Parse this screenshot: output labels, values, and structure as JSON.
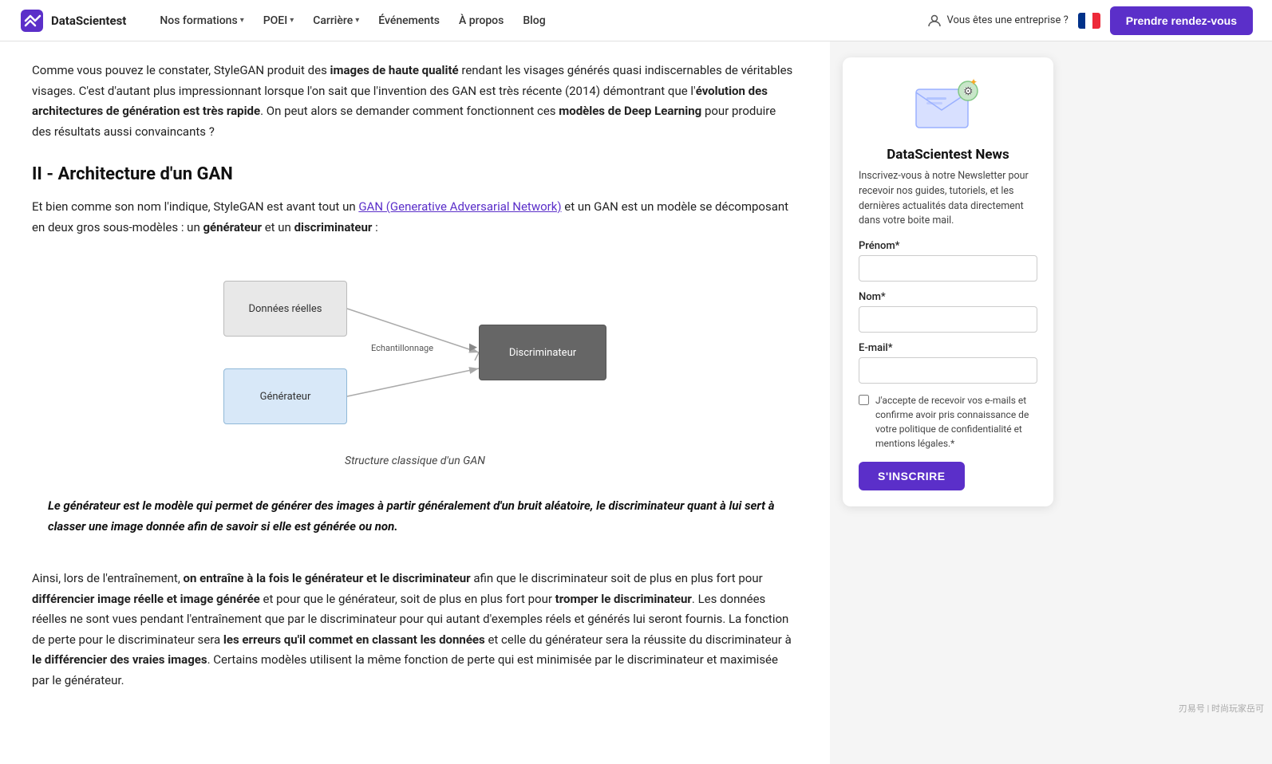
{
  "navbar": {
    "logo_text": "DataScientest",
    "nav_items": [
      {
        "label": "Nos formations",
        "has_dropdown": true
      },
      {
        "label": "POEI",
        "has_dropdown": true
      },
      {
        "label": "Carrière",
        "has_dropdown": true
      },
      {
        "label": "Événements",
        "has_dropdown": false
      },
      {
        "label": "À propos",
        "has_dropdown": false
      },
      {
        "label": "Blog",
        "has_dropdown": false
      }
    ],
    "enterprise_label": "Vous êtes une entreprise ?",
    "cta_label": "Prendre rendez-vous"
  },
  "article": {
    "para1": "Comme vous pouvez le constater, StyleGAN produit des ",
    "para1_bold1": "images de haute qualité",
    "para1_rest": " rendant les visages générés quasi indiscernables de véritables visages. C'est d'autant plus impressionnant lorsque l'on sait que l'invention des GAN est très récente (2014) démontrant que l'",
    "para1_bold2": "évolution des architectures de génération est très rapide",
    "para1_end": ". On peut alors se demander comment fonctionnent ces ",
    "para1_bold3": "modèles de Deep Learning",
    "para1_final": " pour produire des résultats aussi convaincants ?",
    "section_title": "II - Architecture d'un GAN",
    "para2_start": "Et bien comme son nom l'indique, StyleGAN est avant tout un ",
    "para2_link": "GAN (Generative Adversarial Network)",
    "para2_mid": " et un GAN est un modèle se décomposant en deux gros sous-modèles : un ",
    "para2_bold1": "générateur",
    "para2_mid2": " et un ",
    "para2_bold2": "discriminateur",
    "para2_end": " :",
    "diagram_caption": "Structure classique d'un GAN",
    "diagram_labels": {
      "donnees": "Données réelles",
      "generateur": "Générateur",
      "discriminateur": "Discriminateur",
      "echantillonnage": "Echantillonnage"
    },
    "blockquote": "Le générateur est le modèle qui permet de générer des images à partir généralement d'un bruit aléatoire, le discriminateur quant à lui sert à classer une image donnée afin de savoir si elle est générée ou non.",
    "para3_start": "Ainsi, lors de l'entraînement, ",
    "para3_bold1": "on entraîne à la fois le générateur et le discriminateur",
    "para3_mid": " afin que le discriminateur soit de plus en plus fort pour ",
    "para3_bold2": "différencier image réelle et image générée",
    "para3_mid2": " et pour que le générateur, soit de plus en plus fort pour ",
    "para3_bold3": "tromper le discriminateur",
    "para3_end": ". Les données réelles ne sont vues pendant l'entraînement que par le discriminateur pour qui autant d'exemples réels et générés lui seront fournis. La fonction de perte pour le discriminateur sera ",
    "para3_bold4": "les erreurs qu'il commet en classant les données",
    "para3_mid3": " et celle du générateur sera la réussite du discriminateur à ",
    "para3_bold5": "le différencier des vraies images",
    "para3_final": ". Certains modèles utilisent la même fonction de perte qui est minimisée par le discriminateur et maximisée par le générateur."
  },
  "sidebar": {
    "newsletter_title": "DataScientest News",
    "newsletter_desc": "Inscrivez-vous à notre Newsletter pour recevoir nos guides, tutoriels, et les dernières actualités data directement dans votre boite mail.",
    "prenom_label": "Prénom*",
    "prenom_placeholder": "",
    "nom_label": "Nom*",
    "nom_placeholder": "",
    "email_label": "E-mail*",
    "email_placeholder": "",
    "checkbox_label": "J'accepte de recevoir vos e-mails et confirme avoir pris connaissance de votre politique de confidentialité et mentions légales.*",
    "submit_label": "S'INSCRIRE"
  },
  "watermark": "刃易号 | 时尚玩家岳可"
}
